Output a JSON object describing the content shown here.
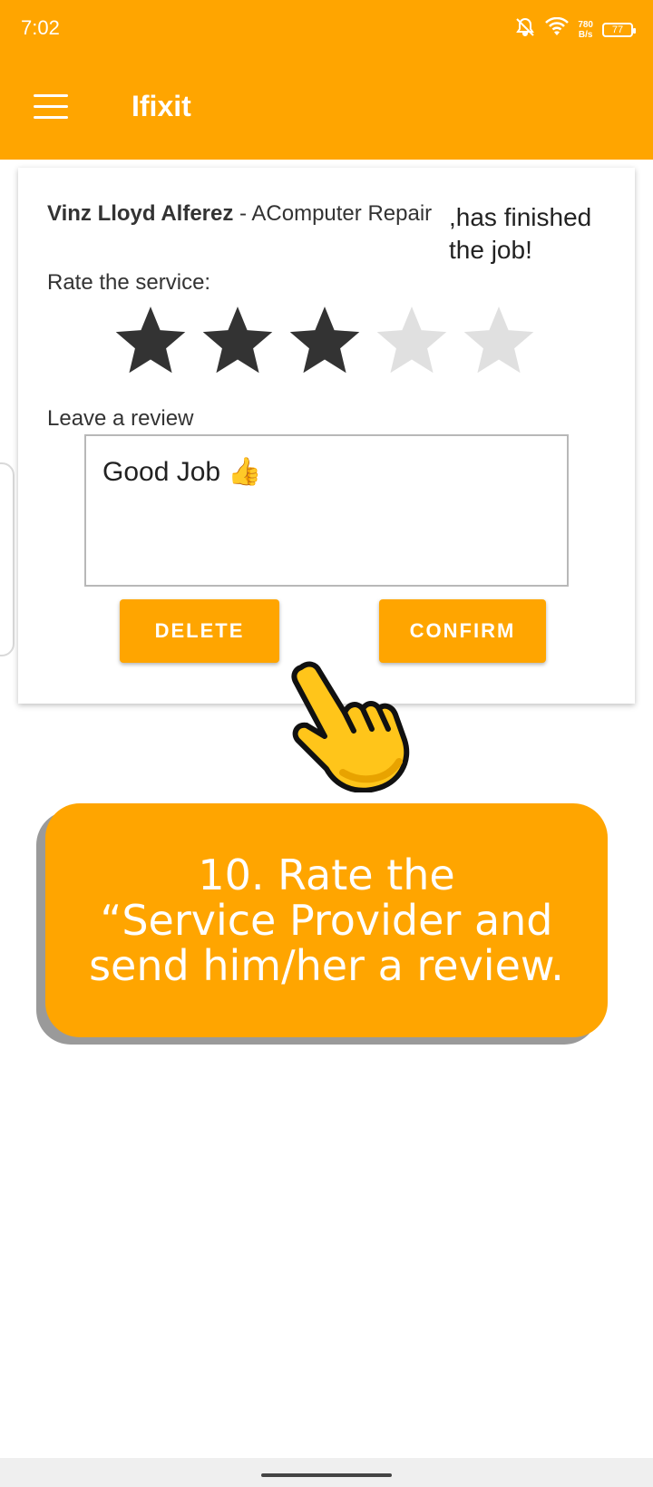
{
  "status_bar": {
    "time": "7:02",
    "net_speed_value": "780",
    "net_speed_unit": "B/s",
    "battery": "77",
    "icons": [
      "bell-off-icon",
      "wifi-icon",
      "battery-icon"
    ]
  },
  "app_bar": {
    "title": "Ifixit",
    "menu_icon": "menu-icon",
    "color": "#ffa500"
  },
  "rating_card": {
    "provider_name": "Vinz Lloyd Alferez",
    "separator": " - ",
    "service": "AComputer Repair",
    "finished_text": ",has finished the job!",
    "rate_label": "Rate the service:",
    "rating": 3,
    "max_rating": 5,
    "star_filled_color": "#333333",
    "star_empty_color": "#e0e0e0",
    "review_label": "Leave a review",
    "review_text": "Good Job 👍",
    "delete_label": "DELETE",
    "confirm_label": "CONFIRM"
  },
  "instruction": {
    "text": "10. Rate the\n“Service Provider and\nsend him/her a review.",
    "pointer_icon": "pointing-hand-icon"
  },
  "nav_bar": {
    "handle": "home-gesture-bar"
  }
}
